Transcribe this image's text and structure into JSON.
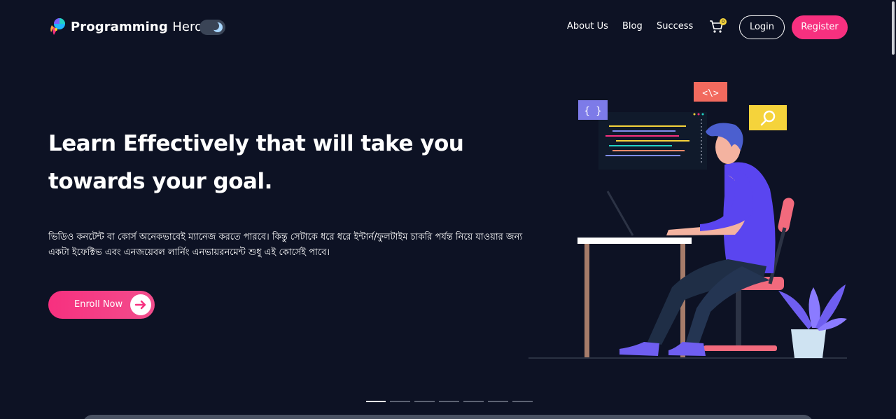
{
  "brand": {
    "name_bold": "Programming",
    "name_light": "Hero",
    "logo_icon": "rocket-swirl-logo"
  },
  "theme_toggle": {
    "icon": "moon-icon"
  },
  "nav": {
    "links": [
      "About Us",
      "Blog",
      "Success"
    ],
    "cart_icon": "cart-icon",
    "cart_count": "0",
    "login": "Login",
    "register": "Register"
  },
  "hero": {
    "title": "Learn Effectively that will take you towards your goal.",
    "description": "ভিডিও কনটেন্ট বা কোর্স অনেকভাবেই ম্যানেজ করতে পারবে। কিন্তু সেটাকে ধরে ধরে ইন্টার্ন/ফুলটাইম চাকরি পর্যন্ত নিয়ে যাওয়ার জন্য একটা ইফেক্টিভ এবং এনজয়েবল লার্নিং এনভায়রনমেন্ট শুধু এই কোর্সেই পাবে।",
    "enroll_label": "Enroll Now",
    "enroll_icon": "arrow-right-icon"
  },
  "illustration": {
    "code_tags": [
      "{ }",
      "<\\>"
    ],
    "search_icon": "search-icon"
  },
  "carousel": {
    "count": 7,
    "active": 0
  },
  "colors": {
    "background": "#0d1224",
    "accent": "#f7307f",
    "toggle": "#3a4456"
  }
}
